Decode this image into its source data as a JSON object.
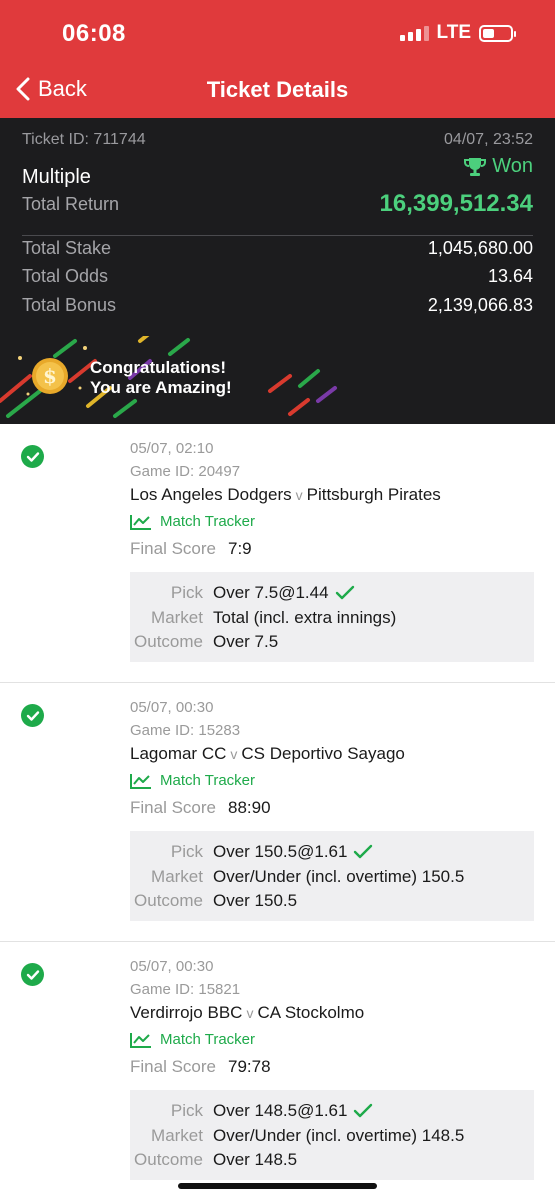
{
  "status": {
    "time": "06:08",
    "network": "LTE"
  },
  "nav": {
    "back_label": "Back",
    "title": "Ticket Details"
  },
  "ticket": {
    "id_label": "Ticket ID: 711744",
    "date": "04/07, 23:52",
    "result": "Won",
    "type": "Multiple",
    "total_return_label": "Total Return",
    "total_return": "16,399,512.34",
    "total_stake_label": "Total Stake",
    "total_stake": "1,045,680.00",
    "total_odds_label": "Total Odds",
    "total_odds": "13.64",
    "total_bonus_label": "Total Bonus",
    "total_bonus": "2,139,066.83"
  },
  "banner": {
    "line1": "Congratulations!",
    "line2": "You are Amazing!"
  },
  "labels": {
    "vs": "v",
    "match_tracker": "Match Tracker",
    "final_score": "Final Score",
    "pick": "Pick",
    "market": "Market",
    "outcome": "Outcome"
  },
  "bets": [
    {
      "datetime": "05/07, 02:10",
      "game_id": "Game ID: 20497",
      "home": "Los Angeles Dodgers",
      "away": "Pittsburgh Pirates",
      "final_score": "7:9",
      "pick": "Over 7.5@1.44",
      "market": "Total (incl. extra innings)",
      "outcome": "Over 7.5"
    },
    {
      "datetime": "05/07, 00:30",
      "game_id": "Game ID: 15283",
      "home": "Lagomar CC",
      "away": "CS Deportivo Sayago",
      "final_score": "88:90",
      "pick": "Over 150.5@1.61",
      "market": "Over/Under (incl. overtime) 150.5",
      "outcome": "Over 150.5"
    },
    {
      "datetime": "05/07, 00:30",
      "game_id": "Game ID: 15821",
      "home": "Verdirrojo BBC",
      "away": "CA Stockolmo",
      "final_score": "79:78",
      "pick": "Over 148.5@1.61",
      "market": "Over/Under (incl. overtime) 148.5",
      "outcome": "Over 148.5"
    }
  ],
  "colors": {
    "header_red": "#e03a3c",
    "dark_bg": "#1c1c1e",
    "won_green": "#4cd07d",
    "success_green": "#1eaa4a"
  }
}
